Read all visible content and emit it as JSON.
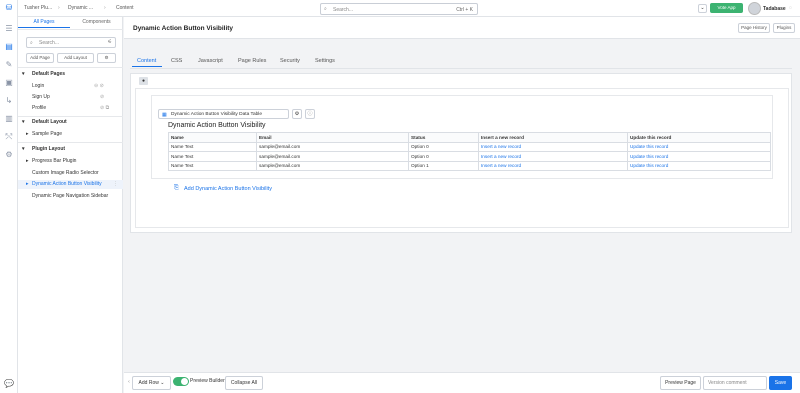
{
  "breadcrumb": {
    "app": "Tusher Plu...",
    "page": "Dynamic ...",
    "section": "Content"
  },
  "search": {
    "placeholder": "Search...",
    "shortcut": "Ctrl + K"
  },
  "header": {
    "vote_label": "Vote App",
    "user": "Tadabase"
  },
  "panel": {
    "tabs": [
      "All Pages",
      "Components"
    ],
    "search_placeholder": "Search...",
    "add_page": "Add Page",
    "add_layout": "Add Layout",
    "sections": {
      "default_pages": "Default Pages",
      "default_layout": "Default Layout",
      "plugin_layout": "Plugin Layout"
    },
    "default_pages": [
      "Login",
      "Sign Up",
      "Profile"
    ],
    "default_layout": [
      "Sample Page"
    ],
    "plugin_layout": [
      "Progress Bar Plugin",
      "Custom Image Radio Selector",
      "Dynamic Action Button Visibility",
      "Dynamic Page Navigation Sidebar"
    ]
  },
  "main": {
    "title": "Dynamic Action Button Visibility",
    "page_history": "Page History",
    "plugins": "Plugins",
    "tabs": [
      "Content",
      "CSS",
      "Javascript",
      "Page Rules",
      "Security",
      "Settings"
    ],
    "component_label": "Dynamic Action Button Visibility Data Table",
    "table_title": "Dynamic Action Button Visibility",
    "add_link": "Add Dynamic Action Button Visibility"
  },
  "table": {
    "headers": [
      "Name",
      "Email",
      "Status",
      "Insert a new record",
      "Update this record"
    ],
    "rows": [
      [
        "Name Text",
        "sample@email.com",
        "Option 0",
        "Insert a new record",
        "Update this record"
      ],
      [
        "Name Text",
        "sample@email.com",
        "Option 0",
        "Insert a new record",
        "Update this record"
      ],
      [
        "Name Text",
        "sample@email.com",
        "Option 1",
        "Insert a new record",
        "Update this record"
      ]
    ]
  },
  "footer": {
    "add_row": "Add Row",
    "preview_builder": "Preview Builder",
    "collapse_all": "Collapse All",
    "preview_page": "Preview Page",
    "version_placeholder": "Version comment",
    "save": "Save"
  },
  "colors": {
    "accent": "#1a73e8",
    "vote": "#3cb371",
    "toggle": "#3cb371"
  }
}
